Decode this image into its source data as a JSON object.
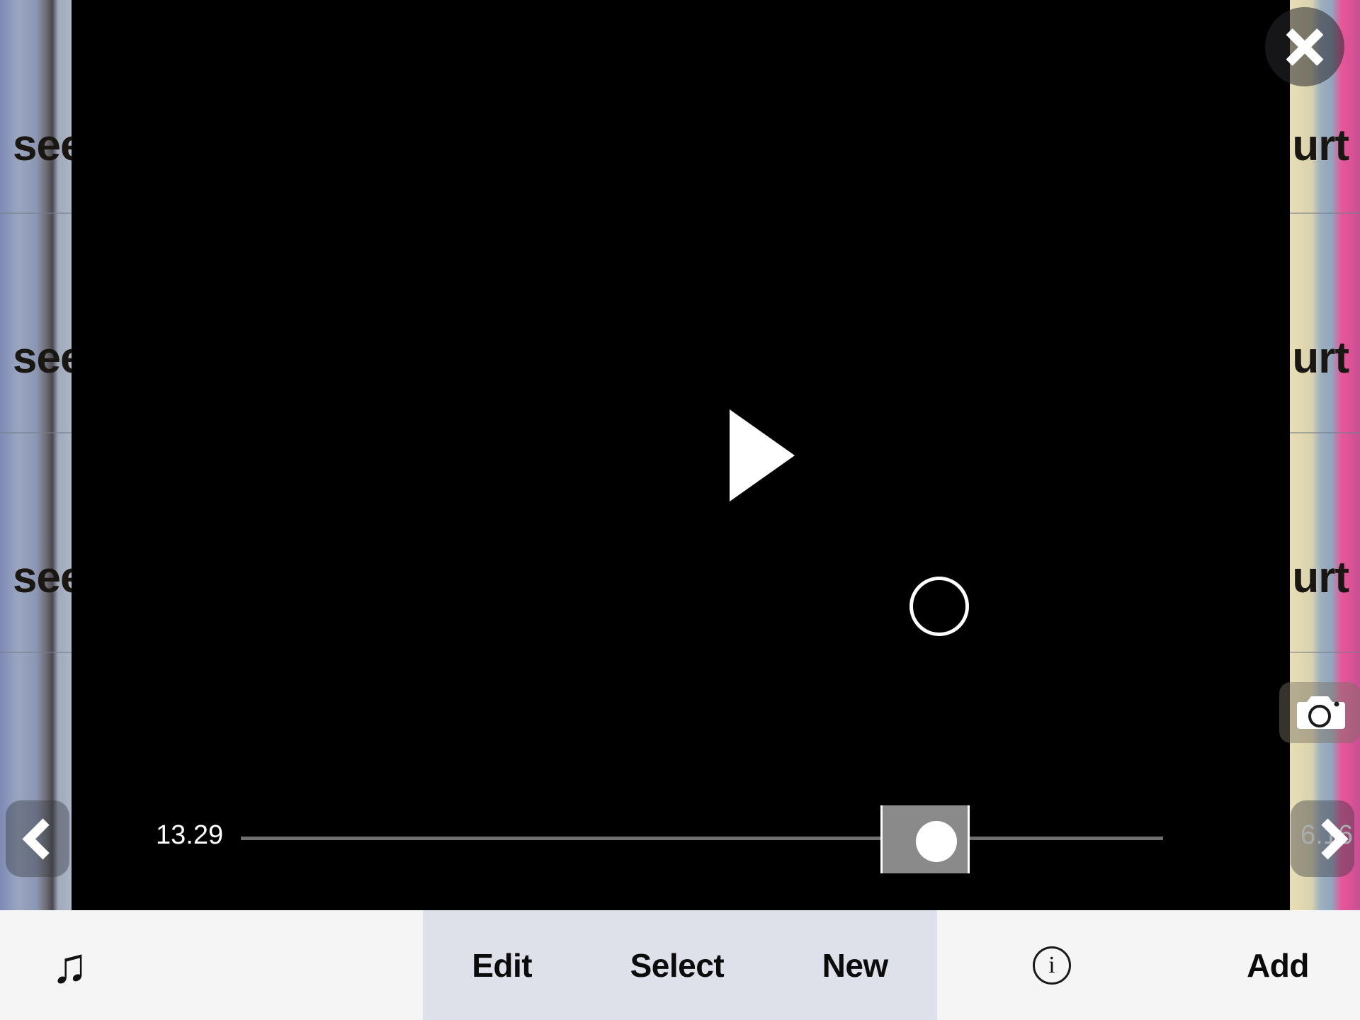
{
  "app": {
    "type": "video-clip-editor",
    "background_word_left": "see",
    "background_word_right": "urt"
  },
  "video": {
    "state": "paused",
    "play_icon": "play-triangle-icon",
    "record_icon": "record-circle-icon",
    "camera_icon": "camera-icon",
    "close_icon": "close-x-icon"
  },
  "scrubber": {
    "time_left": "13.29",
    "time_right": "6.16",
    "thumb_icon": "scrub-thumb",
    "clip_window_icon": "clip-selection-window"
  },
  "nav": {
    "prev_icon": "chevron-left-icon",
    "next_icon": "chevron-right-icon"
  },
  "toolbar": {
    "music_icon": "music-note-icon",
    "music_glyph": "♫",
    "edit_label": "Edit",
    "select_label": "Select",
    "new_label": "New",
    "info_icon": "info-circle-icon",
    "info_glyph": "i",
    "add_label": "Add"
  },
  "colors": {
    "video_background": "#000000",
    "toolbar_background": "#f5f5f6",
    "toolbar_active_segment": "#dee1e9",
    "accent_white": "#ffffff",
    "track": "#6f6f6f",
    "clip_window": "#8a8a8a"
  }
}
